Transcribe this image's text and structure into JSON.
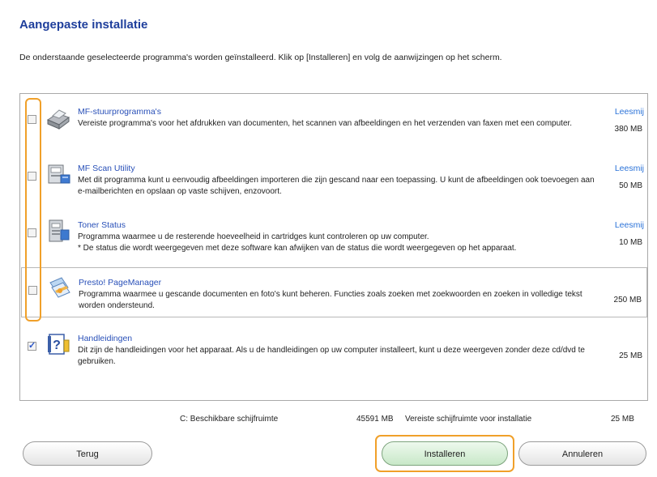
{
  "header": {
    "title": "Aangepaste installatie",
    "instruction": "De onderstaande geselecteerde programma's worden geïnstalleerd. Klik op [Installeren] en volg de aanwijzingen op het scherm."
  },
  "programs": [
    {
      "name": "MF-stuurprogramma's",
      "description": "Vereiste programma's voor het afdrukken van documenten, het scannen van afbeeldingen en het verzenden van faxen met een computer.",
      "readme": "Leesmij",
      "size": "380 MB",
      "checked": false,
      "icon": "printer-icon"
    },
    {
      "name": "MF Scan Utility",
      "description": "Met dit programma kunt u eenvoudig afbeeldingen importeren die zijn gescand naar een toepassing. U kunt de afbeeldingen ook toevoegen aan e-mailberichten en opslaan op vaste schijven, enzovoort.",
      "readme": "Leesmij",
      "size": "50 MB",
      "checked": false,
      "icon": "scanner-icon"
    },
    {
      "name": "Toner Status",
      "description": "Programma waarmee u de resterende hoeveelheid in cartridges kunt controleren op uw computer.\n* De status die wordt weergegeven met deze software kan afwijken van de status die wordt weergegeven op het apparaat.",
      "readme": "Leesmij",
      "size": "10 MB",
      "checked": false,
      "icon": "toner-icon"
    },
    {
      "name": "Presto! PageManager",
      "description": "Programma waarmee u gescande documenten en foto's kunt beheren. Functies zoals zoeken met zoekwoorden en zoeken in volledige tekst worden ondersteund.",
      "readme": "",
      "size": "250 MB",
      "checked": false,
      "icon": "pagemanager-icon"
    },
    {
      "name": "Handleidingen",
      "description": "Dit zijn de handleidingen voor het apparaat. Als u de handleidingen op uw computer installeert, kunt u deze weergeven zonder deze cd/dvd te gebruiken.",
      "readme": "",
      "size": "25 MB",
      "checked": true,
      "icon": "manual-icon"
    }
  ],
  "footer": {
    "available_label": "C: Beschikbare schijfruimte",
    "available_value": "45591 MB",
    "required_label": "Vereiste schijfruimte voor installatie",
    "required_value": "25 MB"
  },
  "buttons": {
    "back": "Terug",
    "install": "Installeren",
    "cancel": "Annuleren"
  },
  "colors": {
    "title": "#1f3f9c",
    "link": "#2a72d8",
    "highlight": "#f0a02a"
  }
}
